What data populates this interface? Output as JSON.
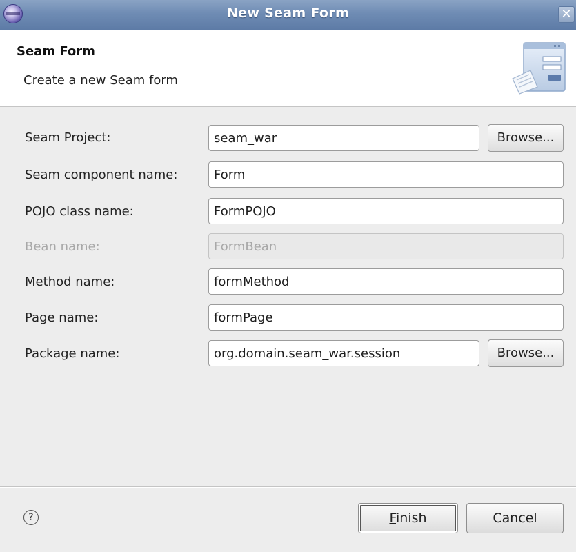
{
  "window": {
    "title": "New Seam Form",
    "close_glyph": "✕"
  },
  "banner": {
    "title": "Seam Form",
    "description": "Create a new Seam form",
    "graphic_icon": "wizard-form-graphic"
  },
  "form": {
    "fields": [
      {
        "label": "Seam Project:",
        "value": "seam_war",
        "enabled": true,
        "has_browse": true
      },
      {
        "label": "Seam component name:",
        "value": "Form",
        "enabled": true,
        "has_browse": false
      },
      {
        "label": "POJO class name:",
        "value": "FormPOJO",
        "enabled": true,
        "has_browse": false
      },
      {
        "label": "Bean name:",
        "value": "FormBean",
        "enabled": false,
        "has_browse": false
      },
      {
        "label": "Method name:",
        "value": "formMethod",
        "enabled": true,
        "has_browse": false
      },
      {
        "label": "Page name:",
        "value": "formPage",
        "enabled": true,
        "has_browse": false
      },
      {
        "label": "Package name:",
        "value": "org.domain.seam_war.session",
        "enabled": true,
        "has_browse": true
      }
    ],
    "browse_label": "Browse..."
  },
  "footer": {
    "help_glyph": "?",
    "finish_mnemonic": "F",
    "finish_rest": "inish",
    "cancel_label": "Cancel"
  },
  "colors": {
    "titlebar": "#6f8cb4",
    "background": "#ededed",
    "disabled_text": "#a8a8a8"
  }
}
